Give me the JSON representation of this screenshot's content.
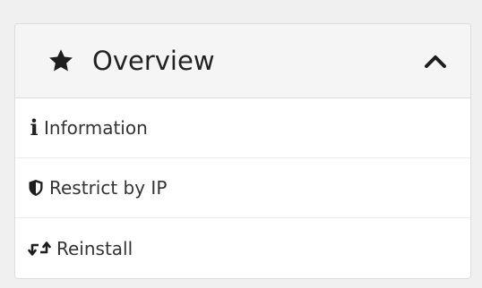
{
  "panel": {
    "title": "Overview",
    "title_icon": "star-icon",
    "toggle_icon": "chevron-up-icon",
    "items": [
      {
        "label": "Information",
        "icon": "info-icon"
      },
      {
        "label": "Restrict by IP",
        "icon": "shield-icon"
      },
      {
        "label": "Reinstall",
        "icon": "retweet-icon"
      }
    ]
  },
  "colors": {
    "page_background": "#f0f0f0",
    "header_background": "#f5f5f5",
    "border": "#dcdcdc",
    "icon": "#222222"
  }
}
